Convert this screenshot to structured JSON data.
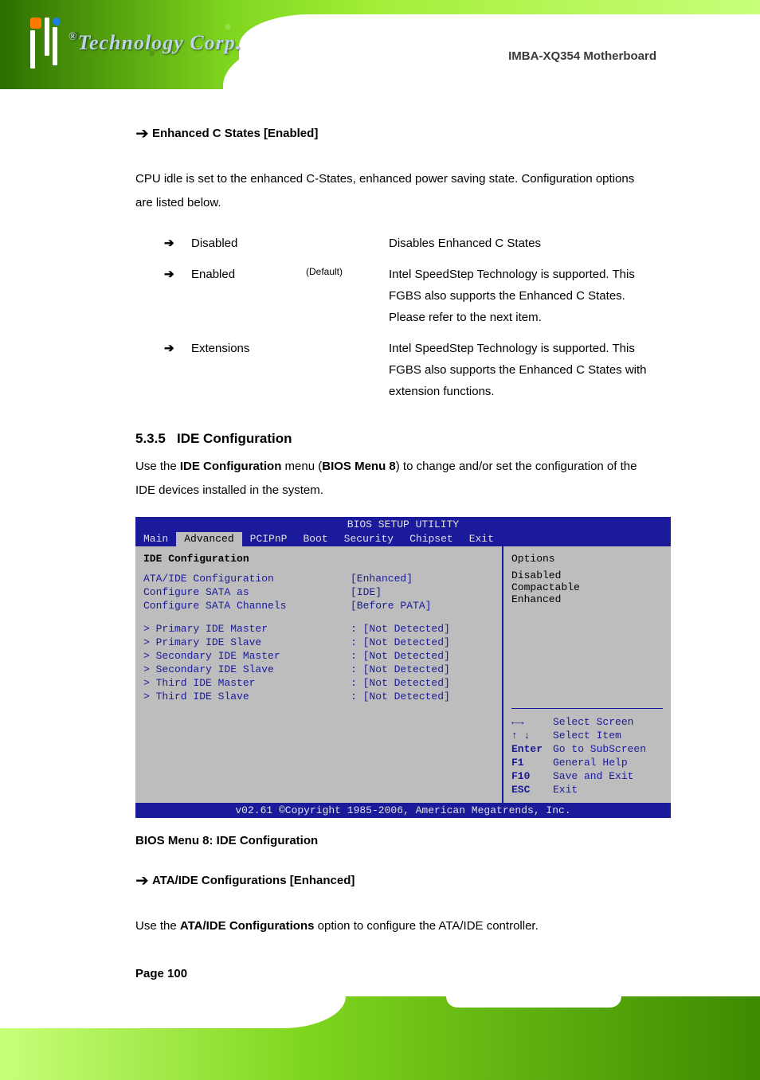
{
  "header": {
    "logo_text": "Technology Corp.",
    "logo_reg": "®"
  },
  "product": "IMBA-XQ354 Motherboard",
  "intro": {
    "label": "Enhanced C States [Enabled]",
    "text": "CPU idle is set to the enhanced C-States, enhanced power saving state. Configuration options are listed below."
  },
  "c1e_options": [
    {
      "key": "Disabled",
      "tag": "",
      "desc": "Disables Enhanced C States"
    },
    {
      "key": "Enabled",
      "tag": "(Default)",
      "desc": "Intel SpeedStep Technology is supported. This FGBS also supports the Enhanced C States. Please refer to the next item."
    },
    {
      "key": "Extensions",
      "tag": "",
      "desc": "Intel SpeedStep Technology is supported. This FGBS also supports the Enhanced C States with extension functions."
    }
  ],
  "section": {
    "num": "5.3.5",
    "title": "IDE Configuration"
  },
  "section_body": "Use the IDE Configuration menu (BIOS Menu 8) to change and/or set the configuration of the IDE devices installed in the system.",
  "bios_menu_ref": "BIOS Menu 8",
  "bios": {
    "title": "BIOS SETUP UTILITY",
    "tabs": [
      "Main",
      "Advanced",
      "PCIPnP",
      "Boot",
      "Security",
      "Chipset",
      "Exit"
    ],
    "active_tab": 1,
    "panel_head": "IDE Configuration",
    "config": [
      {
        "k": "ATA/IDE Configuration",
        "v": "[Enhanced]"
      },
      {
        "k": "Configure SATA as",
        "v": "[IDE]"
      },
      {
        "k": "Configure SATA Channels",
        "v": "[Before PATA]"
      }
    ],
    "drives": [
      {
        "k": "> Primary IDE Master",
        "v": ": [Not Detected]"
      },
      {
        "k": "> Primary IDE Slave",
        "v": ": [Not Detected]"
      },
      {
        "k": "> Secondary IDE Master",
        "v": ": [Not Detected]"
      },
      {
        "k": "> Secondary IDE Slave",
        "v": ": [Not Detected]"
      },
      {
        "k": "> Third IDE Master",
        "v": ": [Not Detected]"
      },
      {
        "k": "> Third IDE Slave",
        "v": ": [Not Detected]"
      }
    ],
    "hint": "Options",
    "hint_opts": [
      "Disabled",
      "Compactable",
      "Enhanced"
    ],
    "keys": [
      {
        "k": "←→",
        "d": "Select Screen"
      },
      {
        "k": "↑ ↓",
        "d": "Select Item"
      },
      {
        "k": "Enter",
        "d": "Go to SubScreen"
      },
      {
        "k": "F1",
        "d": "General Help"
      },
      {
        "k": "F10",
        "d": "Save and Exit"
      },
      {
        "k": "ESC",
        "d": "Exit"
      }
    ],
    "copyright": "v02.61 ©Copyright 1985-2006, American Megatrends, Inc."
  },
  "figure_caption": "BIOS Menu 8: IDE Configuration",
  "ata_ide": {
    "label": "ATA/IDE Configurations [Enhanced]",
    "text_pre": "Use the ",
    "text_bold": "ATA/IDE Configurations",
    "text_post": " option to configure the ATA/IDE controller."
  },
  "page_num": "Page 100"
}
